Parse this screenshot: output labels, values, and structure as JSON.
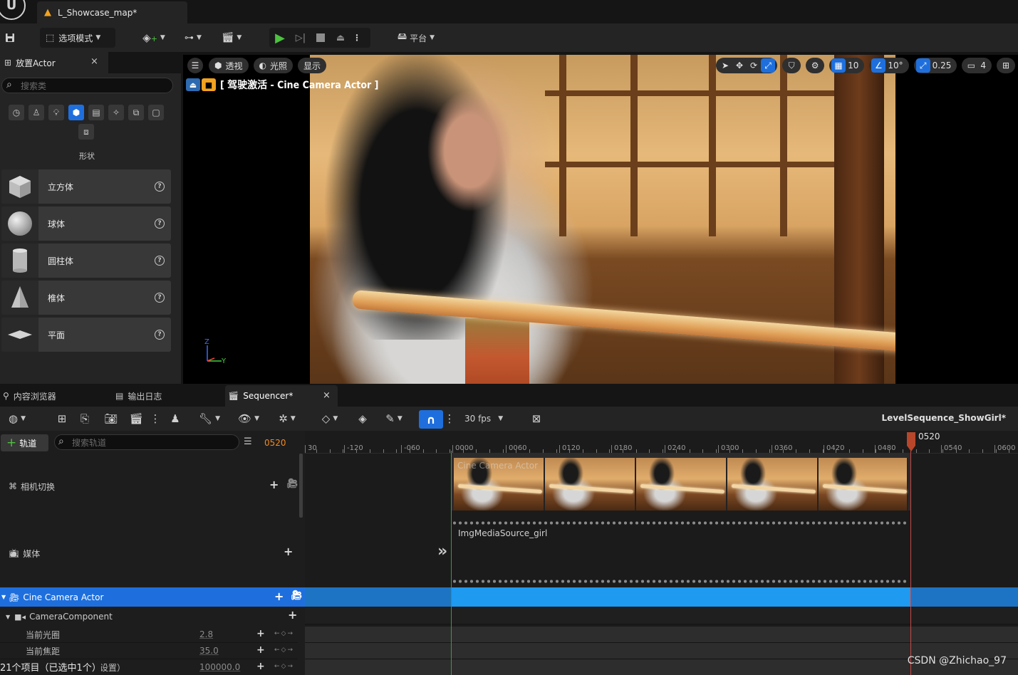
{
  "title_bar": {
    "map_tab_label": "L_Showcase_map*"
  },
  "toolbar": {
    "mode_label": "选项模式",
    "platform_label": "平台"
  },
  "place_actor": {
    "tab_label": "放置Actor",
    "close": "×",
    "search_placeholder": "搜索类",
    "category_label": "形状",
    "items": [
      {
        "label": "立方体",
        "icon": "cube-icon"
      },
      {
        "label": "球体",
        "icon": "sphere-icon"
      },
      {
        "label": "圆柱体",
        "icon": "cylinder-icon"
      },
      {
        "label": "椎体",
        "icon": "cone-icon"
      },
      {
        "label": "平面",
        "icon": "plane-icon"
      }
    ]
  },
  "viewport": {
    "perspective_label": "透视",
    "lighting_label": "光照",
    "show_label": "显示",
    "pilot_label": "[ 驾驶激活 - Cine Camera Actor ]",
    "grid_snap": "10",
    "rotation_snap": "10°",
    "scale_snap": "0.25",
    "camera_speed": "4",
    "gizmo_axes": {
      "z": "Z",
      "y": "Y"
    }
  },
  "bottom_tabs": {
    "content_browser": "内容浏览器",
    "output_log": "输出日志",
    "sequencer": "Sequencer*",
    "close": "×"
  },
  "sequencer": {
    "fps_label": "30 fps",
    "sequence_name": "LevelSequence_ShowGirl*",
    "add_track_label": "轨道",
    "search_placeholder": "搜索轨道",
    "current_frame": "0520",
    "tracks": {
      "camera_cut": "相机切换",
      "media": "媒体",
      "cine_actor": "Cine Camera Actor",
      "camera_component": "CameraComponent"
    },
    "properties": [
      {
        "label": "当前光圈",
        "value": "2.8"
      },
      {
        "label": "当前焦距",
        "value": "35.0"
      },
      {
        "label": "设置）",
        "value": "100000.0"
      }
    ],
    "ruler_labels": [
      "30",
      "-120",
      "-060",
      "0000",
      "0060",
      "0120",
      "0180",
      "0240",
      "0300",
      "0360",
      "0420",
      "0480",
      "0520",
      "0540",
      "0600"
    ],
    "camera_section_label": "Cine Camera Actor",
    "media_section_label": "ImgMediaSource_girl"
  },
  "status_bar": {
    "text": "21个项目（已选中1个）"
  },
  "watermark": "CSDN @Zhichao_97",
  "colors": {
    "accent_blue": "#1e6fdd",
    "play_green": "#4cc23f",
    "frame_orange": "#ef8a22",
    "playhead_red": "#b8462a"
  }
}
